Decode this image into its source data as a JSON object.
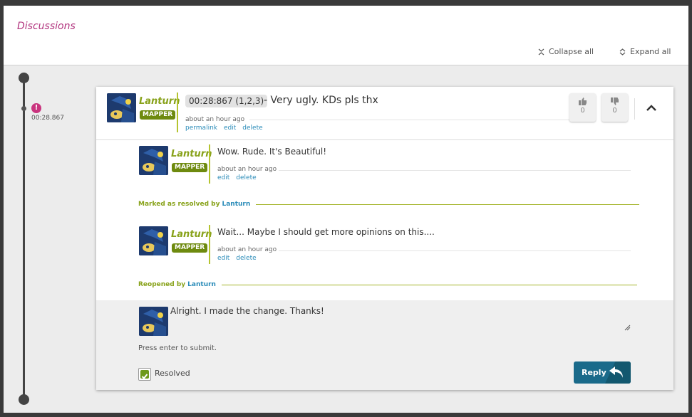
{
  "header": {
    "title": "Discussions",
    "collapse_all": "Collapse all",
    "expand_all": "Expand all"
  },
  "timeline": {
    "timestamp": "00:28.867",
    "alert_glyph": "!"
  },
  "discussion": {
    "author": "Lanturn",
    "badge": "MAPPER",
    "timestamp_ref": "00:28:867 (1,2,3)",
    "message": "- Very ugly. KDs pls thx",
    "time": "about an hour ago",
    "links": {
      "permalink": "permalink",
      "edit": "edit",
      "delete": "delete"
    },
    "votes": {
      "up": "0",
      "down": "0"
    }
  },
  "replies": [
    {
      "author": "Lanturn",
      "badge": "MAPPER",
      "message": "Wow. Rude. It's Beautiful!",
      "time": "about an hour ago",
      "edit": "edit",
      "delete": "delete"
    },
    {
      "author": "Lanturn",
      "badge": "MAPPER",
      "message": "Wait... Maybe I should get more opinions on this....",
      "time": "about an hour ago",
      "edit": "edit",
      "delete": "delete"
    }
  ],
  "status_events": [
    {
      "text": "Marked as resolved by",
      "user": "Lanturn"
    },
    {
      "text": "Reopened by",
      "user": "Lanturn"
    }
  ],
  "compose": {
    "value": "Alright. I made the change. Thanks!",
    "hint": "Press enter to submit.",
    "resolved_label": "Resolved",
    "resolved_checked": true,
    "reply_button": "Reply"
  },
  "colors": {
    "title": "#b2347e",
    "username": "#88a21a",
    "badge": "#6e8a0f",
    "link": "#2b8cb9",
    "reply_button": "#1a6a8a",
    "timeline": "#444444",
    "alert": "#c9347e"
  },
  "icons": [
    "collapse-all-icon",
    "expand-all-icon",
    "alert-icon",
    "thumbs-up-icon",
    "thumbs-down-icon",
    "chevron-up-icon",
    "reply-arrow-icon",
    "checkmark-icon",
    "resize-grip-icon"
  ]
}
